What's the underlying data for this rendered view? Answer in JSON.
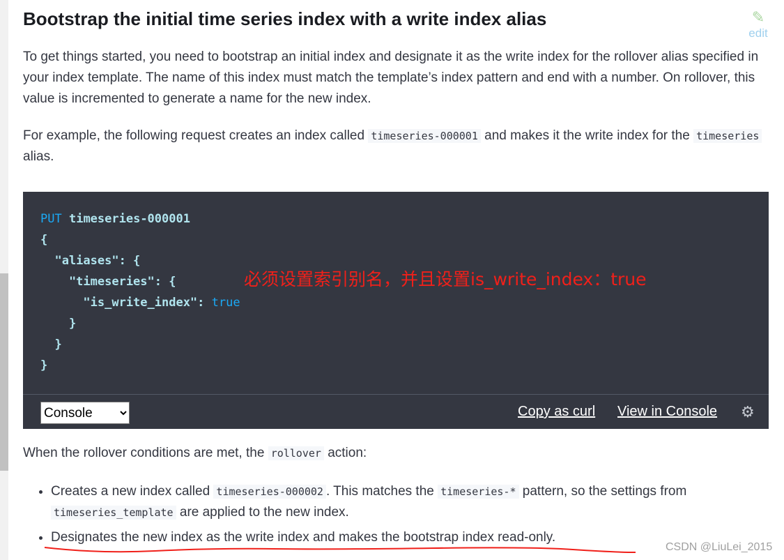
{
  "heading": "Bootstrap the initial time series index with a write index alias",
  "edit_label": "edit",
  "para1": "To get things started, you need to bootstrap an initial index and designate it as the write index for the rollover alias specified in your index template. The name of this index must match the template’s index pattern and end with a number. On rollover, this value is incremented to generate a name for the new index.",
  "para2": {
    "a": "For example, the following request creates an index called ",
    "code1": "timeseries-000001",
    "b": " and makes it the write index for the ",
    "code2": "timeseries",
    "c": " alias."
  },
  "code": {
    "method": "PUT",
    "path": "timeseries-000001",
    "l2": "{",
    "l3": "  \"aliases\": {",
    "l4": "    \"timeseries\": {",
    "l5": "      \"is_write_index\": ",
    "l5v": "true",
    "l6": "    }",
    "l7": "  }",
    "l8": "}"
  },
  "annotation": "必须设置索引别名，并且设置is_write_index：true",
  "toolbar": {
    "select_value": "Console",
    "copy_curl": "Copy as curl",
    "view_console": "View in Console"
  },
  "para3": {
    "a": "When the rollover conditions are met, the ",
    "code": "rollover",
    "b": " action:"
  },
  "bullets": [
    {
      "a": "Creates a new index called ",
      "c1": "timeseries-000002",
      "b": ". This matches the ",
      "c2": "timeseries-*",
      "c": " pattern, so the settings from ",
      "c3": "timeseries_template",
      "d": " are applied to the new index."
    },
    {
      "a": "Designates the new index as the write index and makes the bootstrap index read-only."
    }
  ],
  "watermark": "CSDN @LiuLei_2015",
  "colors": {
    "annotation": "#f0201a",
    "code_bg": "#343741",
    "keyword": "#1ba9f5"
  }
}
